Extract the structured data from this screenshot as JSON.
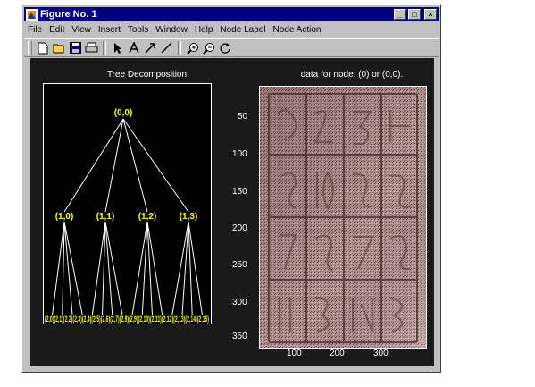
{
  "window": {
    "title": "Figure No. 1",
    "buttons": {
      "minimize": "_",
      "maximize": "□",
      "close": "×"
    }
  },
  "menubar": {
    "items": [
      "File",
      "Edit",
      "View",
      "Insert",
      "Tools",
      "Window",
      "Help",
      "Node Label",
      "Node Action"
    ]
  },
  "toolbar": {
    "icons": [
      "new-icon",
      "open-icon",
      "save-icon",
      "print-icon",
      "pointer-icon",
      "text-icon",
      "arrow-icon",
      "line-icon",
      "zoom-in-icon",
      "zoom-out-icon",
      "rotate-icon"
    ]
  },
  "tree_panel": {
    "title": "Tree Decomposition",
    "root": "(0,0)",
    "level1": [
      "(1,0)",
      "(1,1)",
      "(1,2)",
      "(1,3)"
    ],
    "level2_text": "(2,0)(2,1)(2,2)(2,3)(2,4)(2,5)(2,6)(2,7)(2,8)(2,9)(2,10)(2,11)(2,12)(2,13)(2,14)(2,15)",
    "node_color": "#ffff00"
  },
  "image_panel": {
    "title": "data for node: (0) or (0,0).",
    "y_ticks": [
      "50",
      "100",
      "150",
      "200",
      "250",
      "300",
      "350"
    ],
    "x_ticks": [
      "100",
      "200",
      "300"
    ],
    "tone_color": "#b09090"
  },
  "colors": {
    "titlebar": "#000080",
    "figure_bg": "#1a1a1a",
    "chrome": "#c0c0c0"
  }
}
